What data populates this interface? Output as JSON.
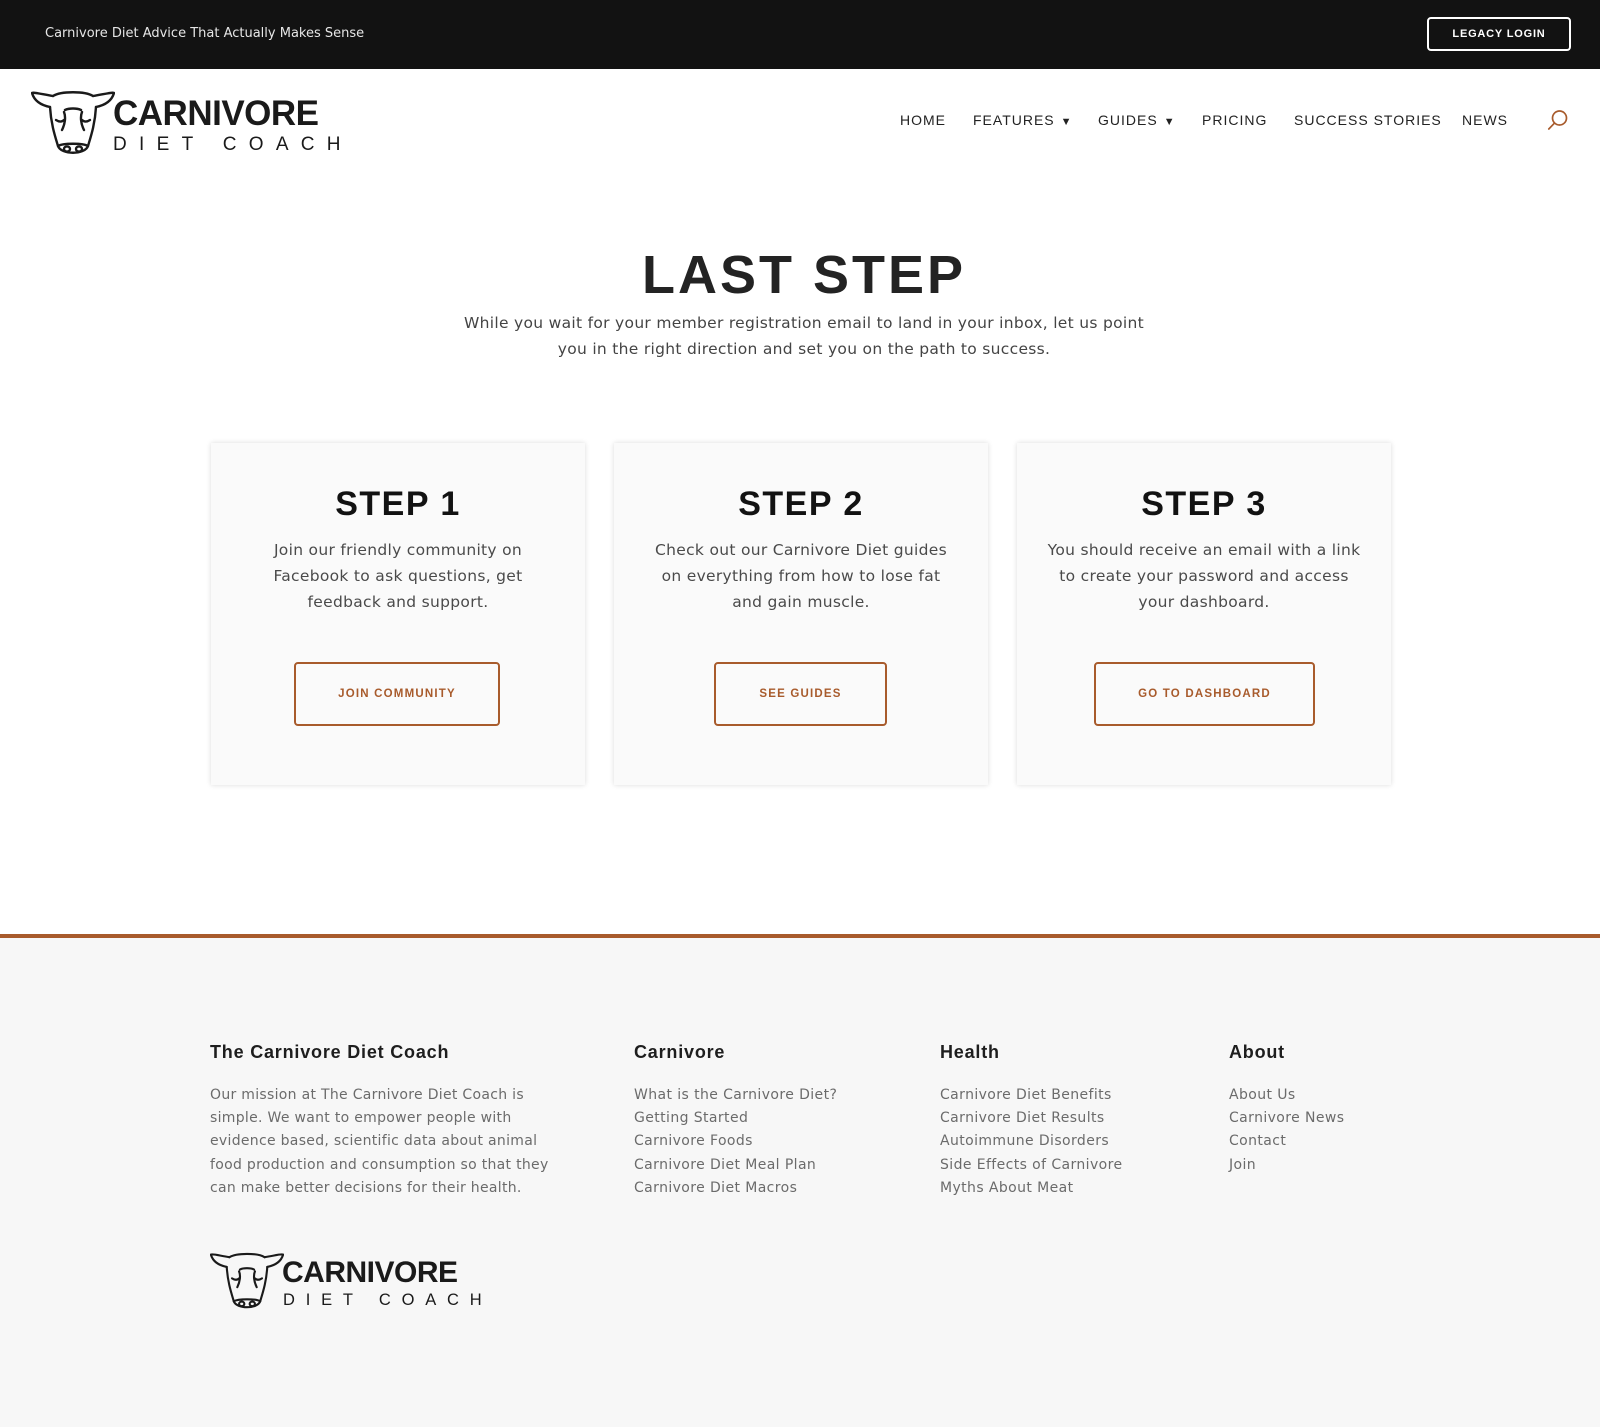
{
  "topbar": {
    "tagline": "Carnivore Diet Advice That Actually Makes Sense",
    "legacy_login": "LEGACY LOGIN",
    "background": "#121212"
  },
  "logo": {
    "line1": "CARNIVORE",
    "line2": "DIET COACH",
    "icon": "bull-head-icon"
  },
  "nav": {
    "items": [
      {
        "label": "HOME"
      },
      {
        "label": "FEATURES",
        "caret": "▼"
      },
      {
        "label": "GUIDES",
        "caret": "▼"
      },
      {
        "label": "PRICING"
      },
      {
        "label": "SUCCESS STORIES"
      },
      {
        "label": "NEWS"
      }
    ],
    "search_icon": "search-icon"
  },
  "hero": {
    "title": "LAST STEP",
    "subtitle": "While you wait for your member registration email to land in your inbox, let us point you in the right direction and set you on the path to success."
  },
  "steps": [
    {
      "title": "STEP 1",
      "description": "Join our friendly community on Facebook to ask questions, get feedback and support.",
      "button": "JOIN COMMUNITY"
    },
    {
      "title": "STEP 2",
      "description": "Check out our Carnivore Diet guides on everything from how to lose fat and gain muscle.",
      "button": "SEE GUIDES"
    },
    {
      "title": "STEP 3",
      "description": "You should receive an email with a link to create your password and access your dashboard.",
      "button": "GO TO DASHBOARD"
    }
  ],
  "footer": {
    "about_col": {
      "heading": "The Carnivore Diet Coach",
      "text": "Our mission at The Carnivore Diet Coach is simple. We want to empower people with evidence based, scientific data about animal food production and consumption so that they can make better decisions for their health."
    },
    "columns": [
      {
        "heading": "Carnivore",
        "links": [
          "What is the Carnivore Diet?",
          "Getting Started",
          "Carnivore Foods",
          "Carnivore Diet Meal Plan",
          "Carnivore Diet Macros"
        ]
      },
      {
        "heading": "Health",
        "links": [
          "Carnivore Diet Benefits",
          "Carnivore Diet Results",
          "Autoimmune Disorders",
          "Side Effects of Carnivore",
          "Myths About Meat"
        ]
      },
      {
        "heading": "About",
        "links": [
          "About Us",
          "Carnivore News",
          "Contact",
          "Join"
        ]
      }
    ]
  },
  "colors": {
    "accent": "#a85b2c",
    "topbar": "#121212",
    "footer_bg": "#f7f7f7",
    "card_bg": "#fafafa"
  }
}
